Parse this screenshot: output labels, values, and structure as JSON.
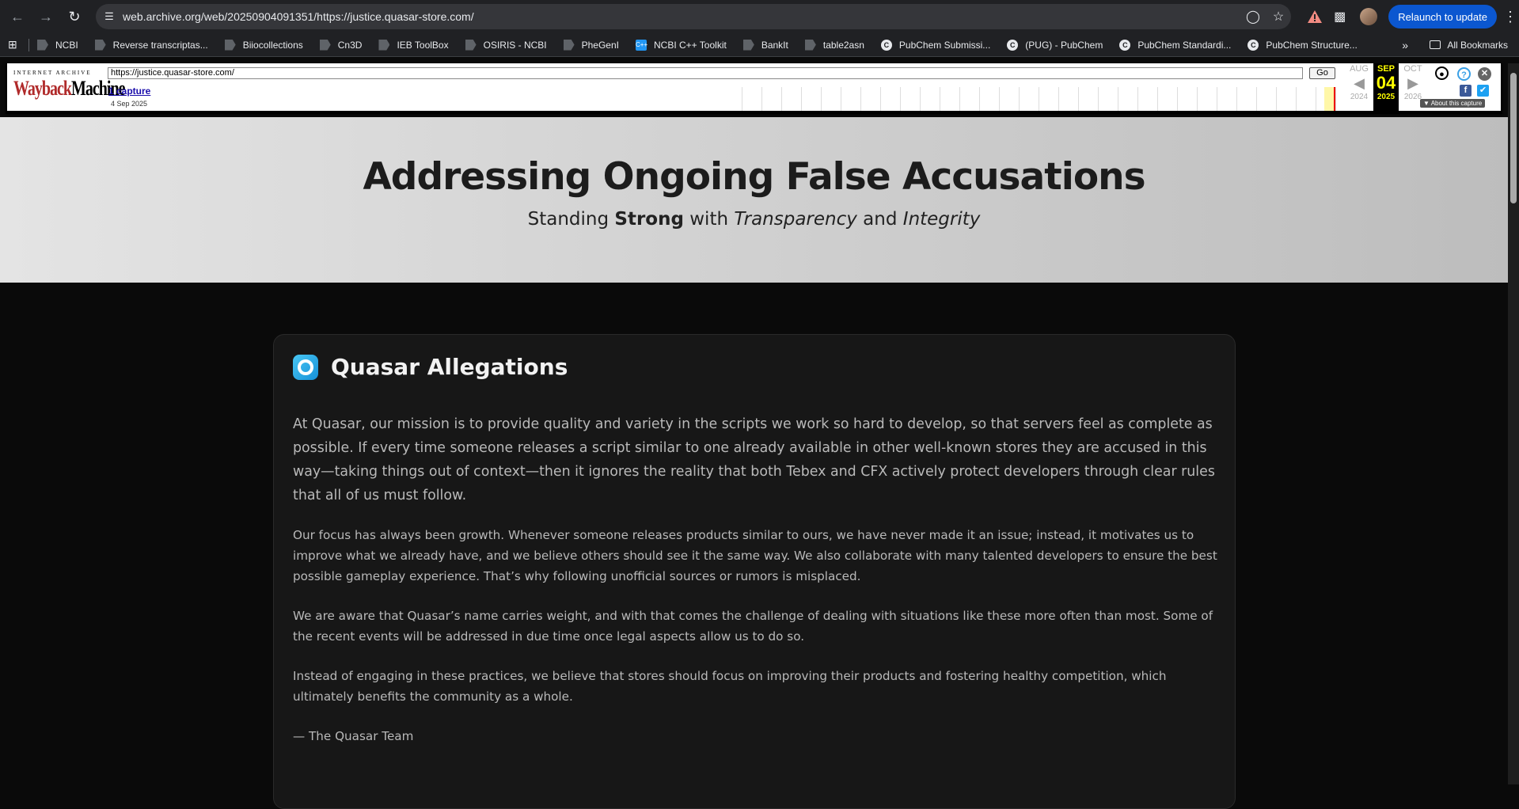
{
  "browser": {
    "url": "web.archive.org/web/20250904091351/https://justice.quasar-store.com/",
    "relaunch_label": "Relaunch to update",
    "bookmarks": [
      {
        "label": "NCBI",
        "icon": "arrow"
      },
      {
        "label": "Reverse transcriptas...",
        "icon": "arrow"
      },
      {
        "label": "Biiocollections",
        "icon": "arrow"
      },
      {
        "label": "Cn3D",
        "icon": "arrow"
      },
      {
        "label": "IEB ToolBox",
        "icon": "arrow"
      },
      {
        "label": "OSIRIS - NCBI",
        "icon": "arrow"
      },
      {
        "label": "PheGenI",
        "icon": "arrow"
      },
      {
        "label": "NCBI C++ Toolkit",
        "icon": "cpp"
      },
      {
        "label": "BankIt",
        "icon": "arrow"
      },
      {
        "label": "table2asn",
        "icon": "arrow"
      },
      {
        "label": "PubChem Submissi...",
        "icon": "circle"
      },
      {
        "label": "(PUG) - PubChem",
        "icon": "circle"
      },
      {
        "label": "PubChem Standardi...",
        "icon": "circle"
      },
      {
        "label": "PubChem Structure...",
        "icon": "circle"
      }
    ],
    "all_bookmarks_label": "All Bookmarks"
  },
  "wayback": {
    "ia_label": "INTERNET ARCHIVE",
    "logo_text_a": "Wayback",
    "logo_text_b": "Machine",
    "url_value": "https://justice.quasar-store.com/",
    "go_label": "Go",
    "captures_label": "1 capture",
    "capture_date": "4 Sep 2025",
    "prev": {
      "month": "AUG",
      "year": "2024"
    },
    "current": {
      "month": "SEP",
      "day": "04",
      "year": "2025"
    },
    "next": {
      "month": "OCT",
      "year": "2026"
    },
    "about_label": "▼ About this capture"
  },
  "hero": {
    "title": "Addressing Ongoing False Accusations",
    "subtitle_parts": [
      "Standing ",
      "Strong",
      " with ",
      "Transparency",
      " and ",
      "Integrity"
    ]
  },
  "card": {
    "title": "Quasar Allegations",
    "lead": "At Quasar, our mission is to provide quality and variety in the scripts we work so hard to develop, so that servers feel as complete as possible. If every time someone releases a script similar to one already available in other well-known stores they are accused in this way—taking things out of context—then it ignores the reality that both Tebex and CFX actively protect developers through clear rules that all of us must follow.",
    "paragraphs": [
      "Our focus has always been growth. Whenever someone releases products similar to ours, we have never made it an issue; instead, it motivates us to improve what we already have, and we believe others should see it the same way. We also collaborate with many talented developers to ensure the best possible gameplay experience. That’s why following unofficial sources or rumors is misplaced.",
      "We are aware that Quasar’s name carries weight, and with that comes the challenge of dealing with situations like these more often than most. Some of the recent events will be addressed in due time once legal aspects allow us to do so.",
      "Instead of engaging in these practices, we believe that stores should focus on improving their products and fostering healthy competition, which ultimately benefits the community as a whole."
    ],
    "signature": "— The Quasar Team"
  },
  "icons": {
    "back": "back-arrow-icon",
    "forward": "forward-arrow-icon",
    "reload": "reload-icon",
    "site_info": "site-info-icon",
    "star": "bookmark-star-icon",
    "warning": "warning-icon",
    "extensions": "puzzle-icon"
  },
  "colors": {
    "relaunch_bg": "#0b57d0",
    "wayback_current_bg": "#000000",
    "wayback_current_fg": "#ffff00",
    "card_bg": "#171717",
    "page_bg": "#0a0a0a"
  }
}
